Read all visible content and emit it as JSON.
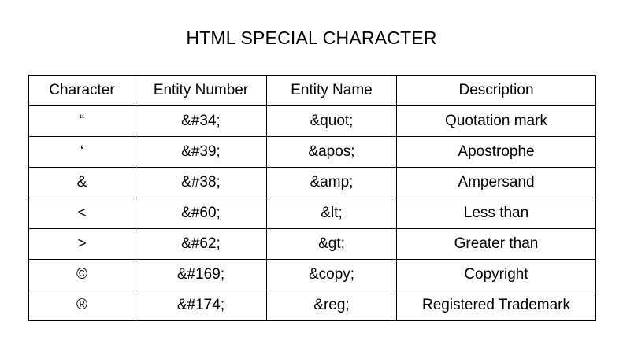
{
  "title": "HTML SPECIAL CHARACTER",
  "headers": [
    "Character",
    "Entity Number",
    "Entity Name",
    "Description"
  ],
  "rows": [
    {
      "character": "“",
      "number": "&#34;",
      "name": "&quot;",
      "description": "Quotation mark"
    },
    {
      "character": "‘",
      "number": "&#39;",
      "name": "&apos;",
      "description": "Apostrophe"
    },
    {
      "character": "&",
      "number": "&#38;",
      "name": "&amp;",
      "description": "Ampersand"
    },
    {
      "character": "<",
      "number": "&#60;",
      "name": "&lt;",
      "description": "Less than"
    },
    {
      "character": ">",
      "number": "&#62;",
      "name": "&gt;",
      "description": "Greater than"
    },
    {
      "character": "©",
      "number": "&#169;",
      "name": "&copy;",
      "description": "Copyright"
    },
    {
      "character": "®",
      "number": "&#174;",
      "name": "&reg;",
      "description": "Registered Trademark"
    }
  ]
}
